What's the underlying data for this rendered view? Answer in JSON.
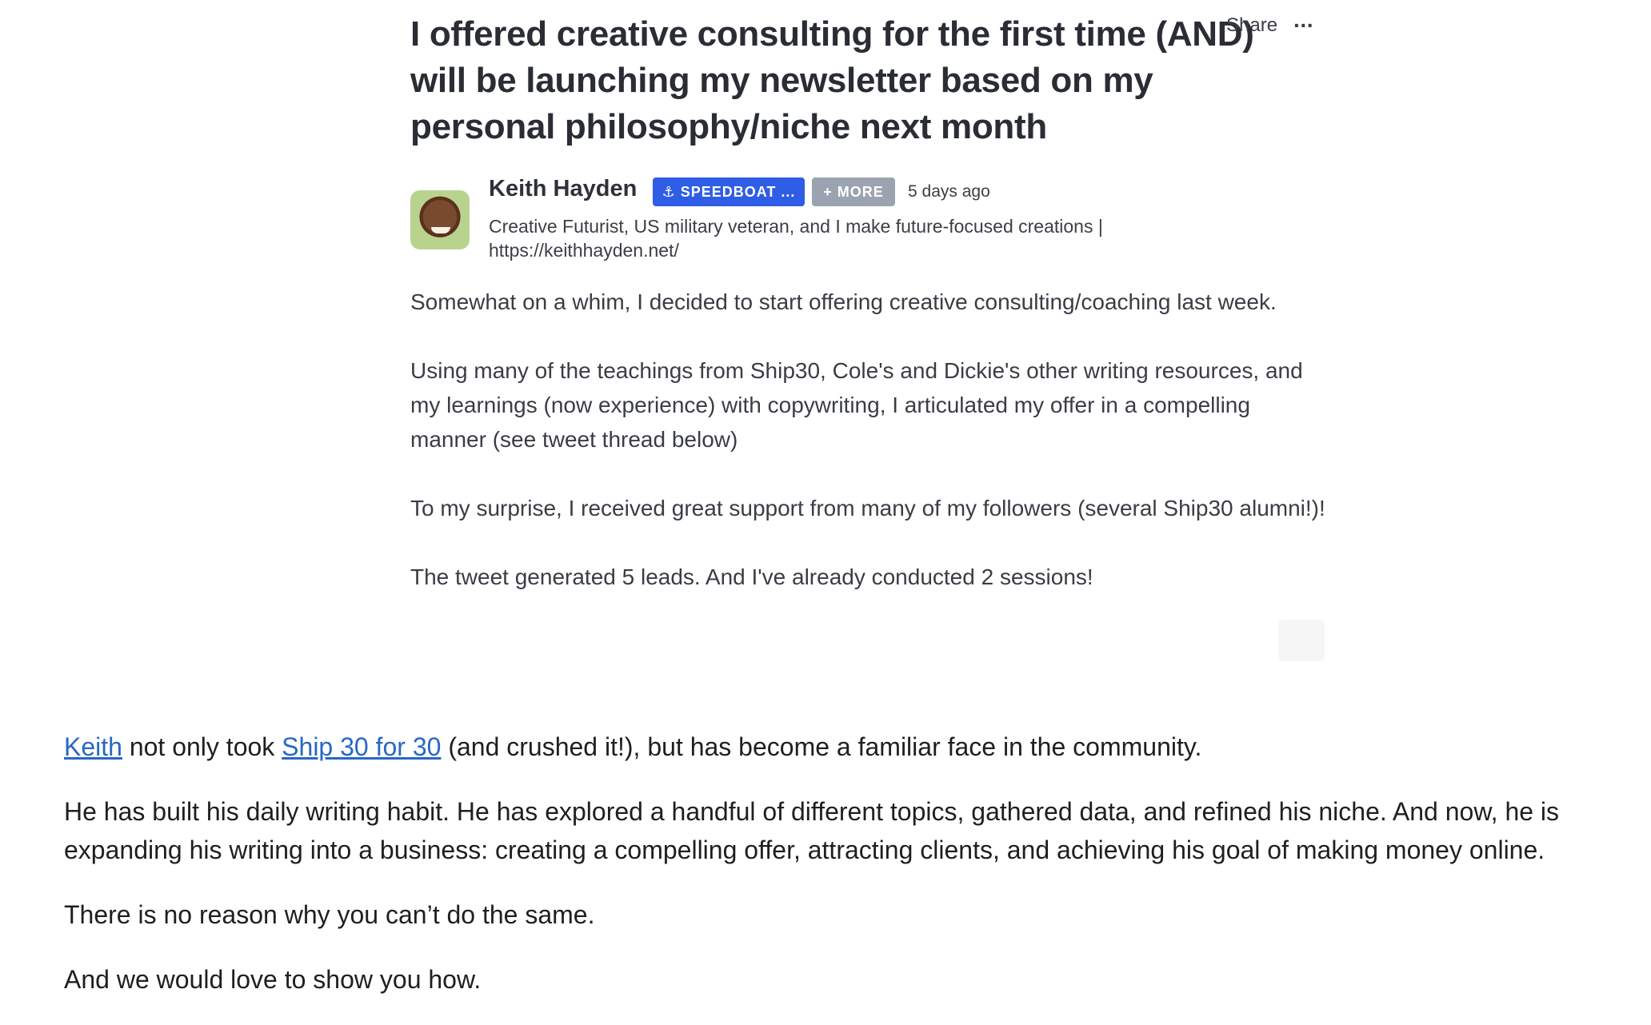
{
  "post": {
    "title": "I offered creative consulting for the first time (AND) will be launching my newsletter based on my personal philosophy/niche next month",
    "share_label": "Share",
    "more_glyph": "···",
    "author": {
      "name": "Keith Hayden",
      "badge_primary": "⚓ SPEEDBOAT ...",
      "badge_secondary": "+ MORE",
      "time_ago": "5 days ago",
      "bio": "Creative Futurist, US military veteran, and I make future-focused creations | https://keithhayden.net/"
    },
    "paragraphs": [
      "Somewhat on a whim, I decided to start offering creative consulting/coaching last week.",
      "Using many of the teachings from Ship30, Cole's and Dickie's other writing resources, and my learnings (now experience) with copywriting, I articulated my offer in a compelling manner (see tweet thread below)",
      "To my surprise, I received great support from many of my followers (several Ship30 alumni!)!",
      "The tweet generated 5 leads. And I've already conducted 2 sessions!"
    ]
  },
  "article": {
    "p1": {
      "link1": "Keith",
      "text1": " not only took ",
      "link2": "Ship 30 for 30",
      "text2": " (and crushed it!), but has become a familiar face in the community."
    },
    "p2": "He has built his daily writing habit. He has explored a handful of different topics, gathered data, and refined his niche. And now, he is expanding his writing into a business: creating a compelling offer, attracting clients, and achieving his goal of making money online.",
    "p3": "There is no reason why you can’t do the same.",
    "p4": "And we would love to show you how."
  },
  "colors": {
    "link": "#2867c5",
    "badge_primary": "#2f5de6",
    "badge_secondary": "#9ca3b0"
  }
}
